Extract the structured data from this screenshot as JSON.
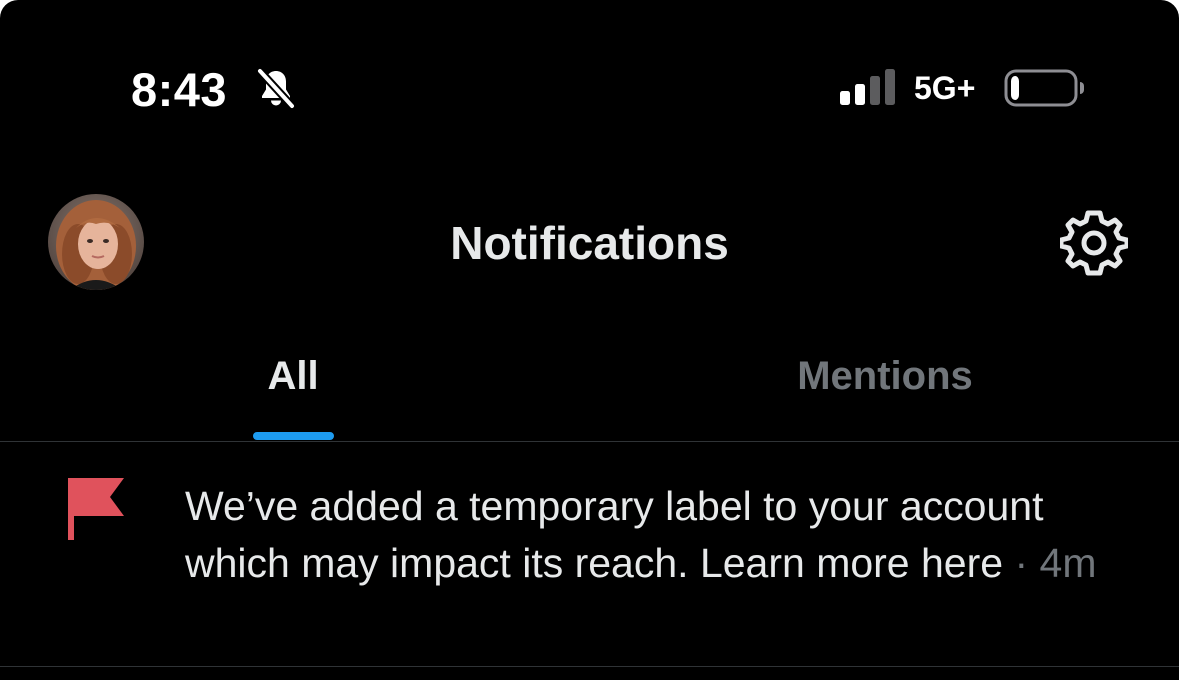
{
  "status_bar": {
    "time": "8:43",
    "mute_icon": "bell-slash-icon",
    "network": "5G+",
    "signal_icon": "cellular-signal-icon",
    "signal_bars_active": 2,
    "signal_bars_total": 4,
    "battery_icon": "battery-icon",
    "battery_level": 0.1
  },
  "header": {
    "title": "Notifications",
    "settings_icon": "gear-icon",
    "avatar_icon": "profile-avatar"
  },
  "tabs": [
    {
      "label": "All",
      "selected": true
    },
    {
      "label": "Mentions",
      "selected": false
    }
  ],
  "notification": {
    "icon": "flag-icon",
    "icon_color": "#e0525c",
    "text": "We’ve added a temporary label to your account which may impact its reach. Learn more here",
    "separator": "·",
    "time": "4m"
  },
  "colors": {
    "background": "#000000",
    "text_primary": "#e7e9ea",
    "text_secondary": "#71767b",
    "accent": "#1d9bf0",
    "divider": "#2f3336"
  }
}
